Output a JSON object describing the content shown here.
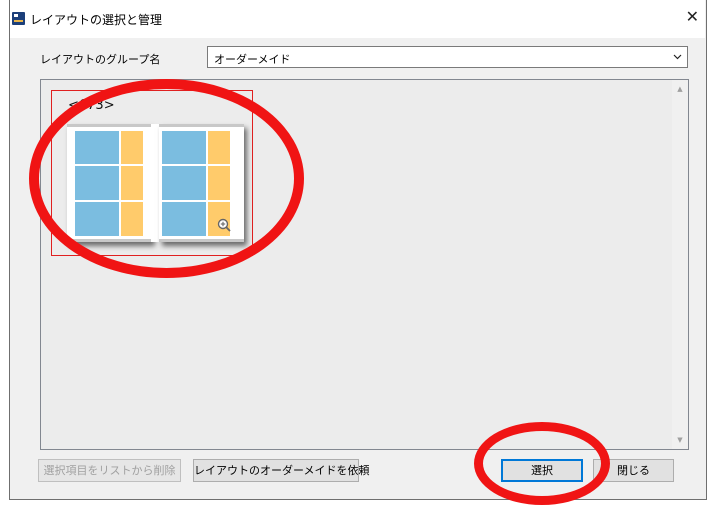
{
  "window": {
    "title": "レイアウトの選択と管理"
  },
  "group": {
    "label": "レイアウトのグループ名",
    "selected": "オーダーメイド"
  },
  "list": {
    "items": [
      {
        "label": "<673>",
        "selected": true
      }
    ]
  },
  "buttons": {
    "remove": "選択項目をリストから削除",
    "request": "レイアウトのオーダーメイドを依頼",
    "select": "選択",
    "close": "閉じる"
  },
  "colors": {
    "slot_blue": "#7bbde0",
    "slot_orange": "#ffcb6b",
    "selection_border": "#e02020",
    "annotation_red": "#f01414",
    "focus_blue": "#0078d7"
  },
  "icons": {
    "app": "app-icon",
    "close": "close-icon",
    "dropdown": "chevron-down-icon",
    "zoom": "zoom-in-icon"
  }
}
